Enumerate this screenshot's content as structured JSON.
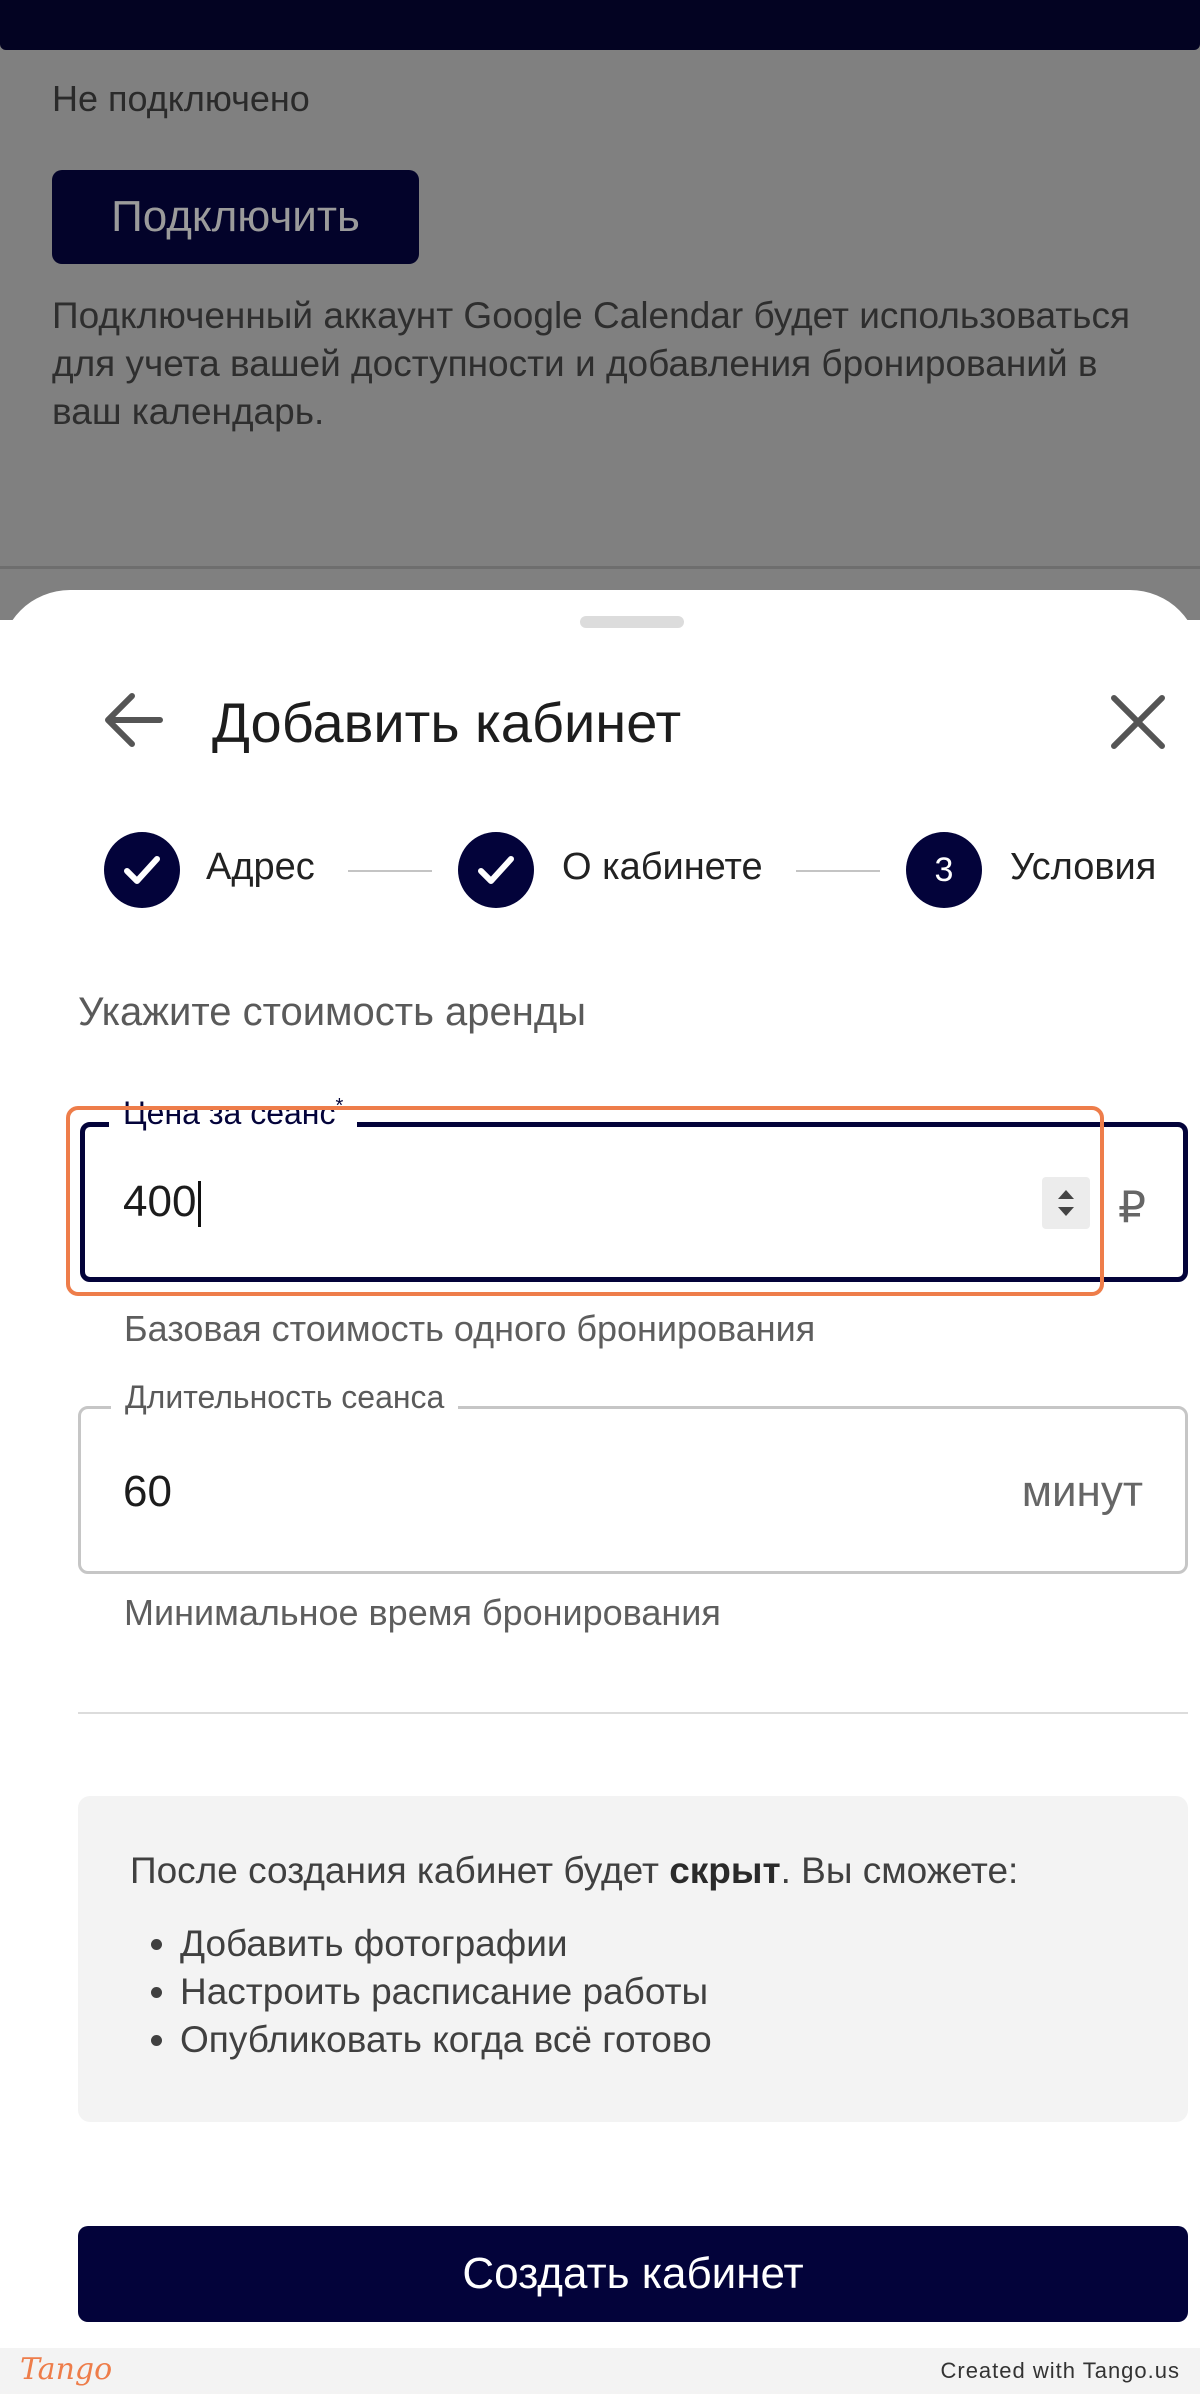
{
  "background": {
    "status": "Не подключено",
    "connect_button": "Подключить",
    "description": "Подключенный аккаунт Google Calendar будет использоваться для учета вашей доступности и добавления бронирований в ваш календарь."
  },
  "sheet": {
    "title": "Добавить кабинет",
    "back_icon": "arrow-left-icon",
    "close_icon": "close-icon"
  },
  "steps": [
    {
      "label": "Адрес",
      "state": "done",
      "icon": "check-icon"
    },
    {
      "label": "О кабинете",
      "state": "done",
      "icon": "check-icon"
    },
    {
      "label": "Условия",
      "state": "current",
      "number": "3"
    }
  ],
  "form": {
    "section_title": "Укажите стоимость аренды",
    "price": {
      "label": "Цена за сеанс",
      "required_mark": "*",
      "value": "400",
      "suffix": "₽",
      "helper": "Базовая стоимость одного бронирования"
    },
    "duration": {
      "label": "Длительность сеанса",
      "value": "60",
      "suffix": "минут",
      "helper": "Минимальное время бронирования"
    }
  },
  "info": {
    "text_before": "После создания кабинет будет ",
    "text_bold": "скрыт",
    "text_after": ". Вы сможете:",
    "items": [
      "Добавить фотографии",
      "Настроить расписание работы",
      "Опубликовать когда всё готово"
    ]
  },
  "create_button": "Создать кабинет",
  "footer": {
    "logo": "Tango",
    "credit": "Created with Tango.us"
  },
  "colors": {
    "primary": "#03033a",
    "highlight": "#ee7d4a",
    "overlay": "#808080"
  }
}
